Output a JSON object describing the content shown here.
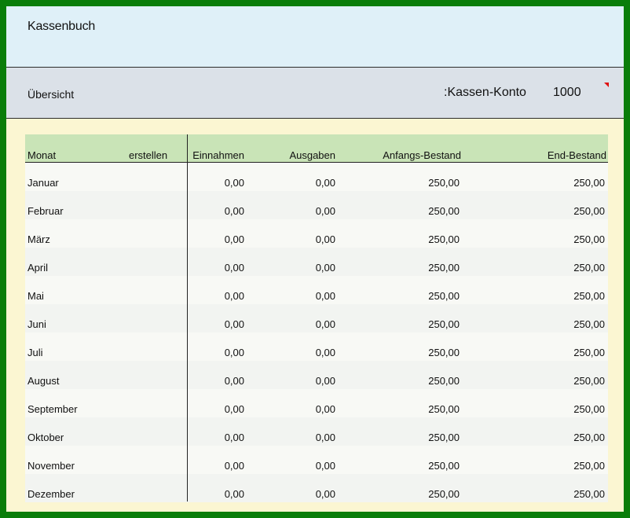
{
  "header": {
    "title": "Kassenbuch"
  },
  "overview": {
    "label": "Übersicht",
    "account_label": ":Kassen-Konto",
    "account_number": "1000"
  },
  "table": {
    "columns": {
      "monat": "Monat",
      "erstellen": "erstellen",
      "einnahmen": "Einnahmen",
      "ausgaben": "Ausgaben",
      "anfangs": "Anfangs-Bestand",
      "end": "End-Bestand"
    },
    "rows": [
      {
        "monat": "Januar",
        "einnahmen": "0,00",
        "ausgaben": "0,00",
        "anfangs": "250,00",
        "end": "250,00"
      },
      {
        "monat": "Februar",
        "einnahmen": "0,00",
        "ausgaben": "0,00",
        "anfangs": "250,00",
        "end": "250,00"
      },
      {
        "monat": "März",
        "einnahmen": "0,00",
        "ausgaben": "0,00",
        "anfangs": "250,00",
        "end": "250,00"
      },
      {
        "monat": "April",
        "einnahmen": "0,00",
        "ausgaben": "0,00",
        "anfangs": "250,00",
        "end": "250,00"
      },
      {
        "monat": "Mai",
        "einnahmen": "0,00",
        "ausgaben": "0,00",
        "anfangs": "250,00",
        "end": "250,00"
      },
      {
        "monat": "Juni",
        "einnahmen": "0,00",
        "ausgaben": "0,00",
        "anfangs": "250,00",
        "end": "250,00"
      },
      {
        "monat": "Juli",
        "einnahmen": "0,00",
        "ausgaben": "0,00",
        "anfangs": "250,00",
        "end": "250,00"
      },
      {
        "monat": "August",
        "einnahmen": "0,00",
        "ausgaben": "0,00",
        "anfangs": "250,00",
        "end": "250,00"
      },
      {
        "monat": "September",
        "einnahmen": "0,00",
        "ausgaben": "0,00",
        "anfangs": "250,00",
        "end": "250,00"
      },
      {
        "monat": "Oktober",
        "einnahmen": "0,00",
        "ausgaben": "0,00",
        "anfangs": "250,00",
        "end": "250,00"
      },
      {
        "monat": "November",
        "einnahmen": "0,00",
        "ausgaben": "0,00",
        "anfangs": "250,00",
        "end": "250,00"
      },
      {
        "monat": "Dezember",
        "einnahmen": "0,00",
        "ausgaben": "0,00",
        "anfangs": "250,00",
        "end": "250,00"
      }
    ]
  },
  "colors": {
    "frame": "#0a7d0a",
    "title_band": "#dff0f8",
    "overview_band": "#dbe1e8",
    "table_header": "#c9e4b7",
    "page_background": "#fbf6d2",
    "marker": "#e01010"
  }
}
